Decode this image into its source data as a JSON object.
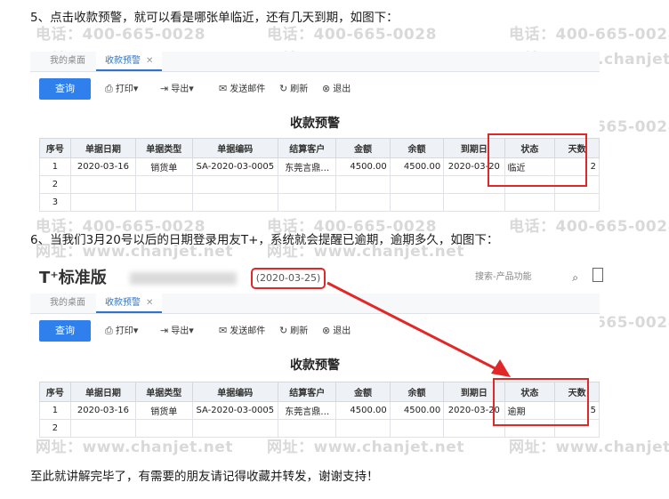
{
  "step5": {
    "text": "5、点击收款预警，就可以看是哪张单临近，还有几天到期，如图下："
  },
  "step6": {
    "text": "6、当我们3月20号以后的日期登录用友T+，系统就会提醒已逾期，逾期多久，如图下："
  },
  "closing": {
    "text": "至此就讲解完毕了，有需要的朋友请记得收藏并转发，谢谢支持！"
  },
  "watermark": {
    "phone": "电话：400-665-0028",
    "web": "网址：www.chanjet.net",
    "web2": "www.chanjet.net"
  },
  "tabs": {
    "home": "我的桌面",
    "active": "收款预警",
    "close": "✕"
  },
  "toolbar": {
    "query": "查询",
    "print": "打印",
    "export": "导出",
    "email": "发送邮件",
    "refresh": "刷新",
    "exit": "退出"
  },
  "icons": {
    "print": "printer-icon",
    "export": "export-icon",
    "email": "mail-icon",
    "refresh": "refresh-icon",
    "exit": "close-circle-icon",
    "search": "search-icon",
    "dropdown": "chevron-down-icon"
  },
  "table_title": "收款预警",
  "columns": [
    "序号",
    "单据日期",
    "单据类型",
    "单据编码",
    "结算客户",
    "金额",
    "余额",
    "到期日",
    "状态",
    "天数"
  ],
  "shot1": {
    "rows": [
      [
        "1",
        "2020-03-16",
        "销货单",
        "SA-2020-03-0005",
        "东莞言鼎…",
        "4500.00",
        "4500.00",
        "2020-03-20",
        "临近",
        "2"
      ],
      [
        "2",
        "",
        "",
        "",
        "",
        "",
        "",
        "",
        "",
        ""
      ],
      [
        "3",
        "",
        "",
        "",
        "",
        "",
        "",
        "",
        "",
        ""
      ]
    ]
  },
  "shot2": {
    "brand": "T⁺标准版",
    "login_date": "(2020-03-25)",
    "search_placeholder": "搜索-产品功能",
    "rows": [
      [
        "1",
        "2020-03-16",
        "销货单",
        "SA-2020-03-0005",
        "东莞言鼎…",
        "4500.00",
        "4500.00",
        "2020-03-20",
        "逾期",
        "5"
      ],
      [
        "2",
        "",
        "",
        "",
        "",
        "",
        "",
        "",
        "",
        ""
      ]
    ]
  },
  "colors": {
    "accent": "#2f80ed",
    "annotation": "#e02828",
    "overdue": "#e03030"
  }
}
